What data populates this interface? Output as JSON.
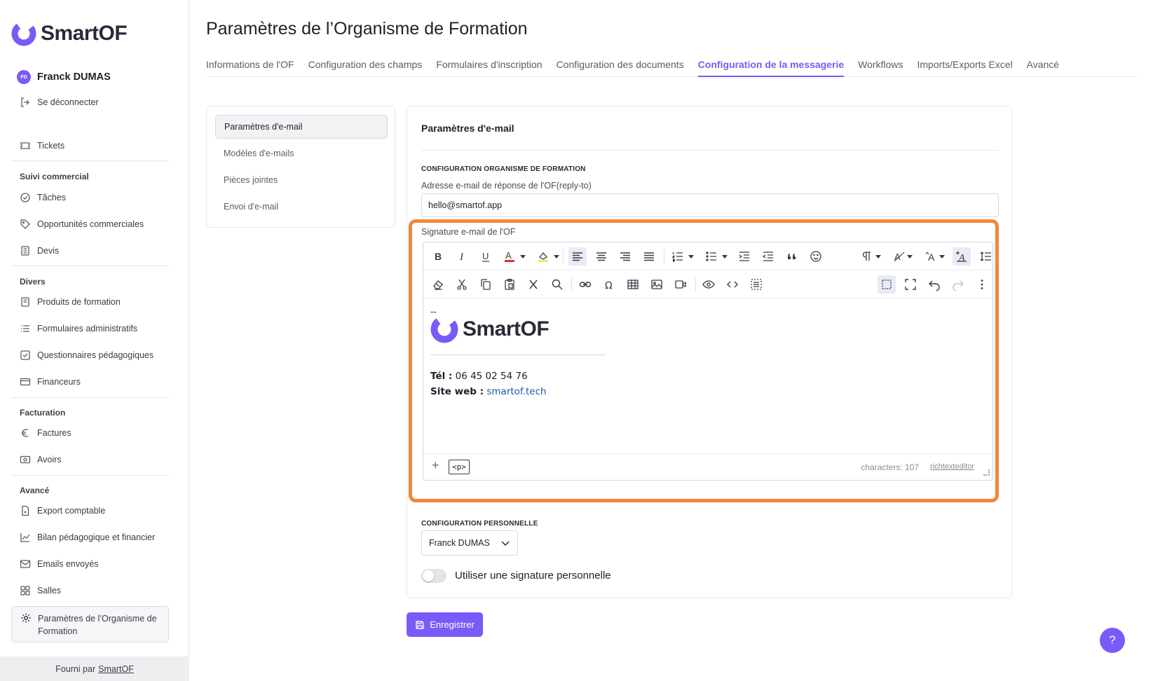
{
  "app": {
    "logo_text": "SmartOF",
    "user_initials": "FD",
    "user_name": "Franck DUMAS",
    "logout_label": "Se déconnecter"
  },
  "sidebar": {
    "tickets": "Tickets",
    "sections": {
      "commercial": "Suivi commercial",
      "divers": "Divers",
      "facturation": "Facturation",
      "avance": "Avancé"
    },
    "items": {
      "taches": "Tâches",
      "opportunites": "Opportunités commerciales",
      "devis": "Devis",
      "produits": "Produits de formation",
      "formulaires": "Formulaires administratifs",
      "questionnaires": "Questionnaires pédagogiques",
      "financeurs": "Financeurs",
      "factures": "Factures",
      "avoirs": "Avoirs",
      "export": "Export comptable",
      "bilan": "Bilan pédagogique et financier",
      "emails": "Emails envoyés",
      "salles": "Salles",
      "parametres": "Paramètres de l’Organisme de Formation"
    },
    "footer_prefix": "Fourni par",
    "footer_link": "SmartOF"
  },
  "page": {
    "title": "Paramètres de l’Organisme de Formation",
    "tabs": [
      "Informations de l'OF",
      "Configuration des champs",
      "Formulaires d'inscription",
      "Configuration des documents",
      "Configuration de la messagerie",
      "Workflows",
      "Imports/Exports Excel",
      "Avancé"
    ],
    "active_tab": "Configuration de la messagerie"
  },
  "subnav": {
    "items": [
      "Paramètres d'e-mail",
      "Modèles d'e-mails",
      "Pièces jointes",
      "Envoi d'e-mail"
    ],
    "active": "Paramètres d'e-mail"
  },
  "settings": {
    "title": "Paramètres d'e-mail",
    "org_section": "CONFIGURATION ORGANISME DE FORMATION",
    "reply_to_label": "Adresse e-mail de réponse de l'OF(reply-to)",
    "reply_to_value": "hello@smartof.app",
    "signature_label": "Signature e-mail de l'OF",
    "signature": {
      "dashes": "--",
      "logo_text": "SmartOF",
      "tel_label": "Tél :",
      "tel_value": "06 45 02 54 76",
      "web_label": "Site web :",
      "web_value": "smartof.tech"
    },
    "editor_footer": {
      "tag": "<p>",
      "characters": "characters: 107",
      "brand": "richtexteditor"
    },
    "personal_section": "CONFIGURATION PERSONNELLE",
    "personal_select": "Franck DUMAS",
    "personal_toggle_label": "Utiliser une signature personnelle",
    "personal_toggle_on": false,
    "save_label": "Enregistrer"
  },
  "colors": {
    "accent": "#7a5af8",
    "highlight": "#f0883a",
    "link": "#1a5aa8",
    "font_color_swatch": "#e03131",
    "highlight_swatch": "#f5e663"
  },
  "help_label": "?"
}
